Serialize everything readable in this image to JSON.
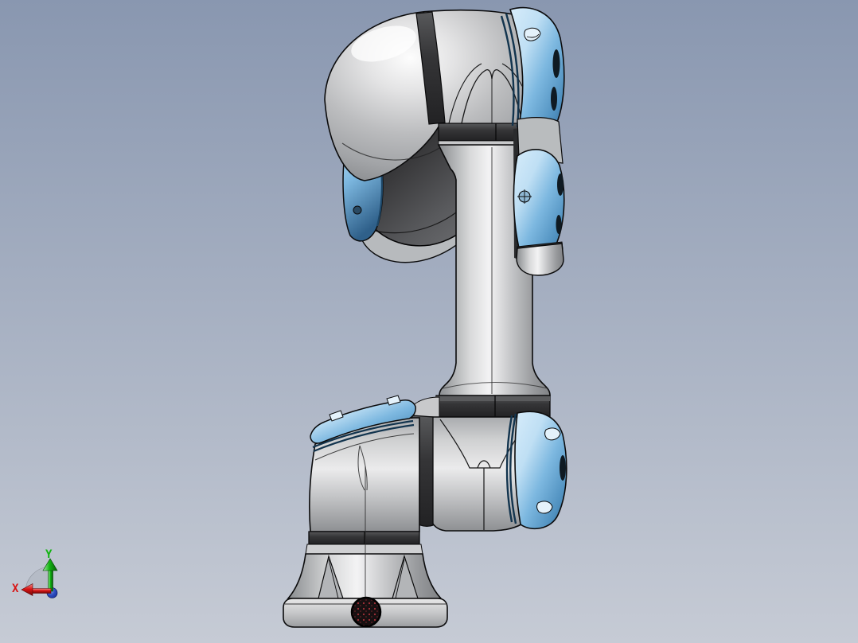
{
  "viewport": {
    "kind": "3d-cad-viewport"
  },
  "triad": {
    "x_label": "X",
    "y_label": "Y"
  },
  "palette": {
    "bg_top": "#8997b0",
    "bg_bottom": "#c6cbd5",
    "body_light": "#f3f3f4",
    "body_mid": "#bcbdbf",
    "body_dark": "#86888b",
    "outline": "#0b0b0c",
    "band_dark": "#353537",
    "joint_dark": "#222224",
    "cap_blue_light": "#bfdff4",
    "cap_blue": "#7db8e0",
    "cap_blue_dark": "#2f608a",
    "connector_red": "#a63038",
    "connector_body": "#171011",
    "axis_x": "#d81414",
    "axis_y": "#12b412",
    "axis_z": "#1b2f9e"
  },
  "model": {
    "parts": [
      "base-pedestal",
      "shoulder-joint-assembly",
      "upper-arm-tube",
      "elbow-joint-housing",
      "wrist-joint-assembly-left",
      "wrist-joint-assembly-right",
      "tool-flange"
    ]
  }
}
